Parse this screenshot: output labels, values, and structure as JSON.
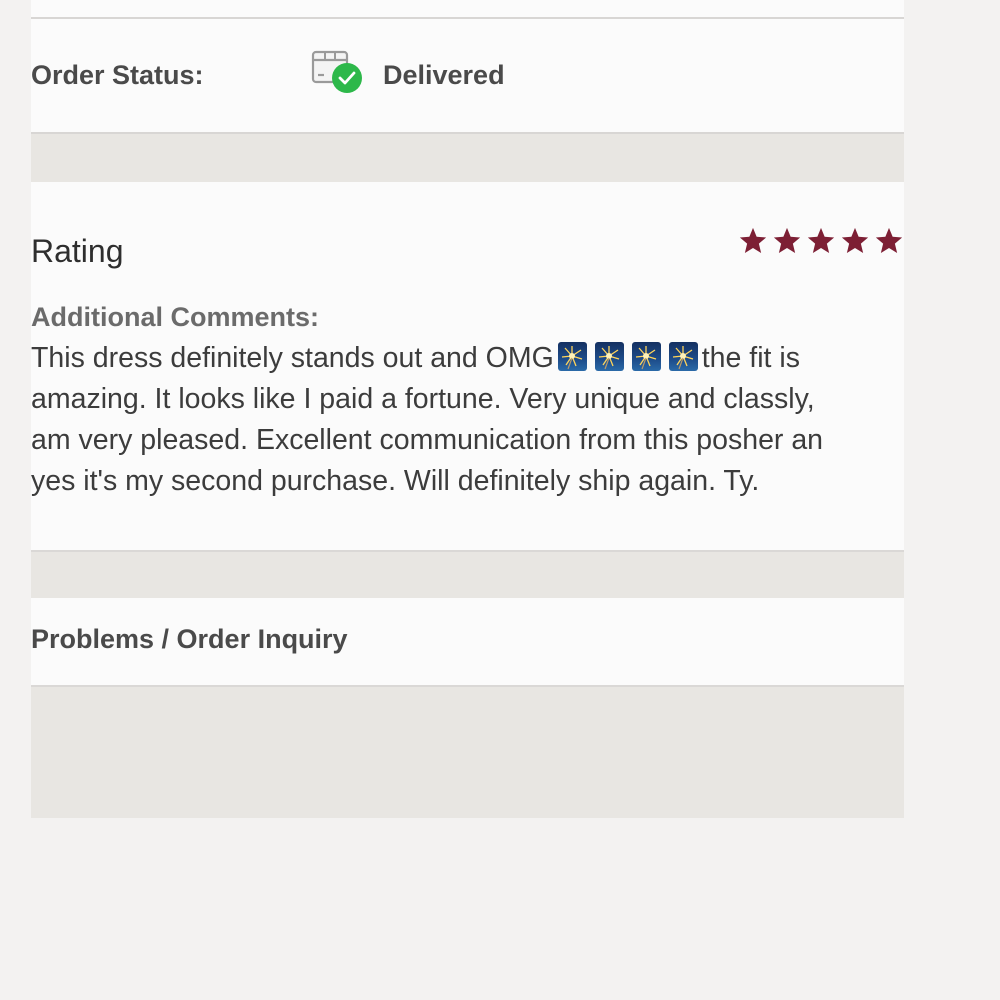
{
  "order_status": {
    "label": "Order Status:",
    "value": "Delivered",
    "icon": "package-delivered-icon",
    "check_color": "#2db84a"
  },
  "rating": {
    "title": "Rating",
    "stars": 5,
    "max_stars": 5,
    "star_color": "#7d1f34"
  },
  "comments": {
    "label": "Additional Comments:",
    "line1_before": "This dress definitely stands out and OMG",
    "emoji": [
      "sparkler-icon",
      "sparkler-icon",
      "sparkler-icon",
      "sparkler-icon"
    ],
    "line1_after": "the fit is",
    "line2": "amazing. It looks like I paid a fortune. Very unique and classly,",
    "line3": "am very pleased. Excellent communication from this posher an",
    "line4": "yes it's my second purchase. Will definitely ship again. Ty."
  },
  "problems": {
    "label": "Problems / Order Inquiry"
  }
}
